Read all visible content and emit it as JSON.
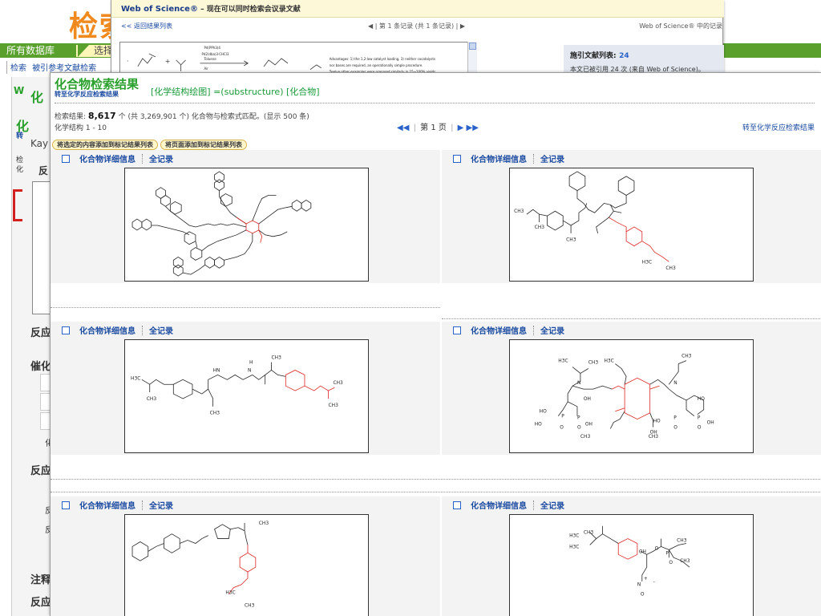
{
  "bg": {
    "title": "检索",
    "tab_all": "所有数据库",
    "tab_select": "选择",
    "subnav": [
      "检索",
      "被引参考文献检索"
    ],
    "fragments": [
      "化",
      "W",
      "化",
      "转",
      "Kay",
      "检",
      "化",
      "反",
      "反应",
      "催化",
      "化",
      "反应",
      "反",
      "反",
      "注释",
      "反应"
    ]
  },
  "wos": {
    "brand": "Web of Science®",
    "tagline": " – 现在可以同时检索会议录文献",
    "back_link": "<< 返回结果列表",
    "pager": "◀ | 第 1 条记录 (共 1 条记录) | ▶",
    "right_link": "Web of Science® 中的记录",
    "cited_label": "施引文献列表:",
    "cited_count": "24",
    "cited_line2": "本文已被引用 24 次 (来自 Web of Science)。",
    "figure_text": [
      "Pd(PPh3)4",
      "Pd2(dba)3·CHCl3",
      "Toluene",
      "Air",
      "Advantages: 1) the 1,2-low catalyst loading, 3) neither cocatalysts",
      "nor bases are required, an operationally simple procedure.",
      "Twelve other examples were prepared similarly in 15~100% yields."
    ]
  },
  "main": {
    "title": "化合物检索结果",
    "sub_link": "转至化学反应检索结果",
    "query": "[化学结构绘图] =(substructure) [化合物]",
    "result_prefix": "检索结果:",
    "result_count": "8,617",
    "result_suffix": "个 (共 3,269,901 个) 化合物与检索式匹配。(显示 500 条)",
    "range": "化学结构 1 - 10",
    "pager": {
      "first": "◀◀",
      "prev": "◀",
      "page": "第 1 页",
      "next": "▶",
      "last": "▶▶"
    },
    "switch_link": "转至化学反应检索结果",
    "actions": [
      "将选定的内容添加到标记结果列表",
      "将页面添加到标记结果列表"
    ],
    "cell_link_detail": "化合物详细信息",
    "cell_link_full": "全记录",
    "compounds": [
      {
        "id": "c1"
      },
      {
        "id": "c2",
        "labels": [
          "CH3",
          "CH3",
          "CH3",
          "H3C",
          "CH3"
        ]
      },
      {
        "id": "c3",
        "labels": [
          "H3C",
          "CH3",
          "HN",
          "N",
          "H",
          "CH3",
          "CH3",
          "CH3",
          "CH3"
        ]
      },
      {
        "id": "c4",
        "labels": [
          "H3C",
          "CH3",
          "H3C",
          "CH3",
          "HO",
          "HO",
          "OH",
          "OH",
          "HO",
          "OH",
          "HO",
          "OH",
          "CH3",
          "CH3",
          "N",
          "N",
          "P",
          "P",
          "P",
          "P",
          "O",
          "O",
          "O",
          "O"
        ]
      },
      {
        "id": "c5",
        "labels": [
          "CH3",
          "H3C",
          "CH3"
        ]
      },
      {
        "id": "c6",
        "labels": [
          "CH3",
          "H3C",
          "H3C",
          "OH",
          "O",
          "CH3",
          "P",
          "O",
          "CH3",
          "N",
          "O",
          "+",
          "-"
        ]
      }
    ]
  }
}
